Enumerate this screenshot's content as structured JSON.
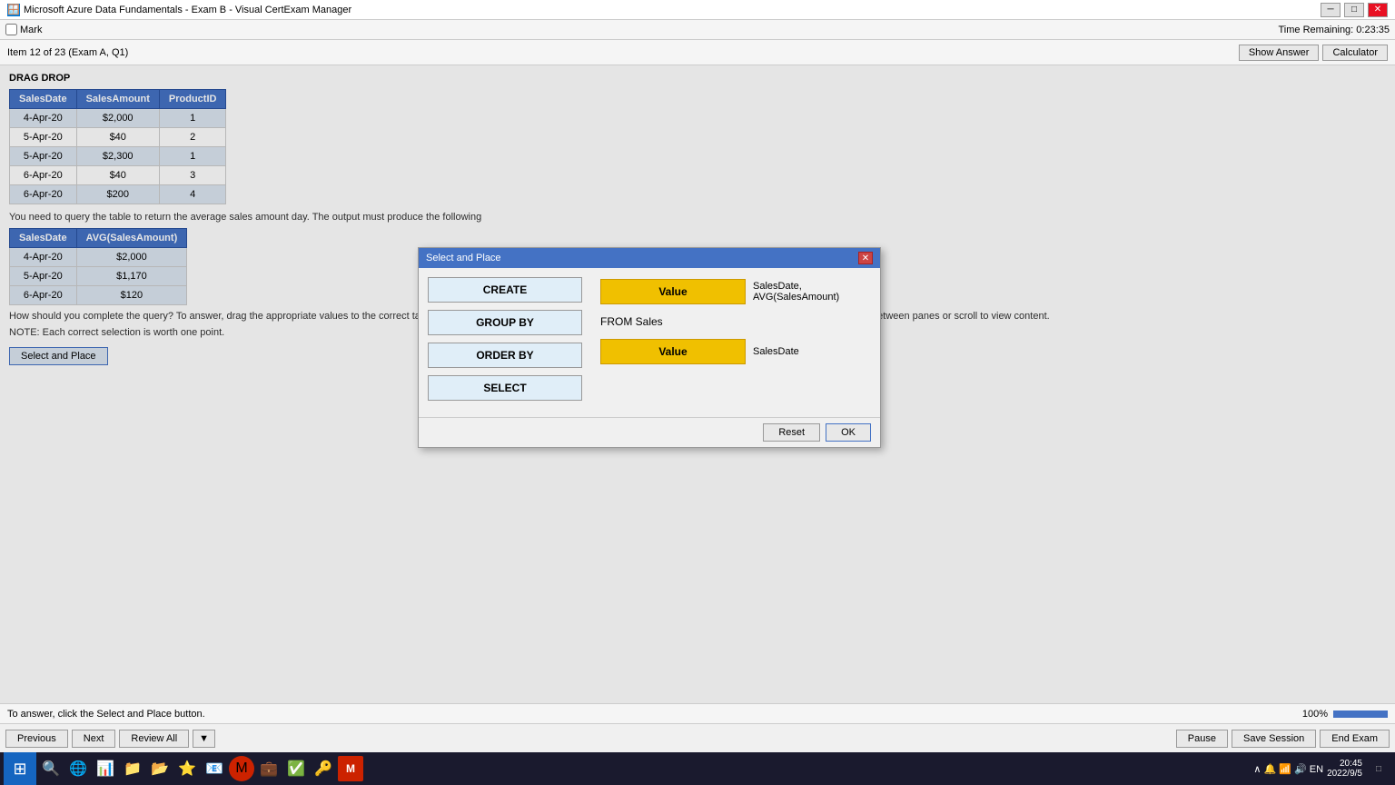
{
  "titlebar": {
    "title": "Microsoft Azure Data Fundamentals - Exam B - Visual CertExam Manager",
    "icon": "🪟",
    "min_label": "─",
    "restore_label": "□",
    "close_label": "✕"
  },
  "menubar": {
    "mark_label": "Mark"
  },
  "toolbar": {
    "item_info": "Item 12 of 23  (Exam A, Q1)",
    "show_answer_label": "Show Answer",
    "calculator_label": "Calculator"
  },
  "drag_drop": {
    "section_label": "DRAG DROP",
    "table1": {
      "headers": [
        "SalesDate",
        "SalesAmount",
        "ProductID"
      ],
      "rows": [
        [
          "4-Apr-20",
          "$2,000",
          "1"
        ],
        [
          "5-Apr-20",
          "$40",
          "2"
        ],
        [
          "5-Apr-20",
          "$2,300",
          "1"
        ],
        [
          "6-Apr-20",
          "$40",
          "3"
        ],
        [
          "6-Apr-20",
          "$200",
          "4"
        ]
      ]
    },
    "question_text": "You need to query the table to return the average sales amount day. The output must produce the following",
    "table2": {
      "headers": [
        "SalesDate",
        "AVG(SalesAmount)"
      ],
      "rows": [
        [
          "4-Apr-20",
          "$2,000"
        ],
        [
          "5-Apr-20",
          "$1,170"
        ],
        [
          "6-Apr-20",
          "$120"
        ]
      ]
    },
    "instruction_text": "How should you complete the query? To answer, drag the appropriate values to the correct targets. Each value may be used once, more than once, or not at all. You may need to drag the split bar between panes or scroll to view content.",
    "note_text": "NOTE: Each correct selection is worth one point.",
    "select_place_button": "Select and Place"
  },
  "modal": {
    "title": "Select and Place",
    "close_label": "✕",
    "keywords": [
      {
        "id": "create",
        "label": "CREATE"
      },
      {
        "id": "group_by",
        "label": "GROUP BY"
      },
      {
        "id": "order_by",
        "label": "ORDER BY"
      },
      {
        "id": "select",
        "label": "SELECT"
      }
    ],
    "right_panel": {
      "row1_value": "Value",
      "row1_label": "SalesDate,\nAVG(SalesAmount)",
      "row2_text": "FROM Sales",
      "row3_value": "Value",
      "row3_label": "SalesDate"
    },
    "reset_label": "Reset",
    "ok_label": "OK"
  },
  "status_bar": {
    "answer_text": "To answer, click the Select and Place button.",
    "zoom_label": "100%"
  },
  "nav_bar": {
    "previous_label": "Previous",
    "next_label": "Next",
    "review_all_label": "Review All",
    "dropdown_arrow": "▼",
    "pause_label": "Pause",
    "save_session_label": "Save Session",
    "end_exam_label": "End Exam"
  },
  "taskbar": {
    "icons": [
      "⊞",
      "🔵",
      "📊",
      "📁",
      "📂",
      "🌐",
      "⭐",
      "📧",
      "💼",
      "✅",
      "🔑",
      "🔴"
    ],
    "tray": {
      "time": "20:45",
      "date": "2022/9/5"
    }
  },
  "time_remaining": {
    "label": "Time Remaining: 0:23:35"
  }
}
